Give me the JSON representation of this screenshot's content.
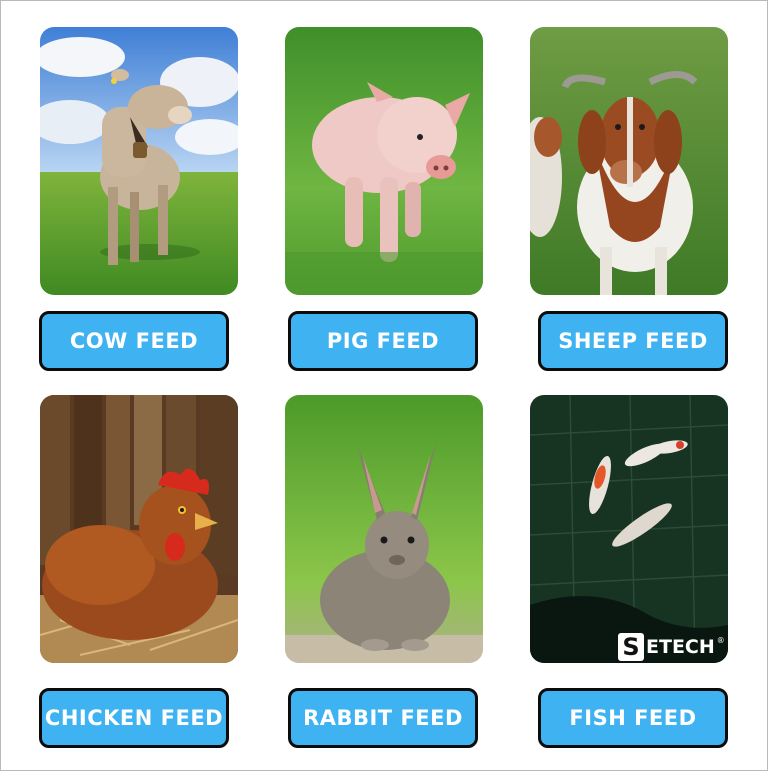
{
  "cards": [
    {
      "animal": "cow",
      "label": "COW FEED"
    },
    {
      "animal": "pig",
      "label": "PIG FEED"
    },
    {
      "animal": "goat",
      "label": "SHEEP FEED"
    },
    {
      "animal": "chicken",
      "label": "CHICKEN FEED"
    },
    {
      "animal": "rabbit",
      "label": "RABBIT FEED"
    },
    {
      "animal": "fish",
      "label": "FISH FEED"
    }
  ],
  "logo": {
    "initial": "S",
    "text": "ETECH",
    "reg_mark": "®"
  },
  "colors": {
    "button_fill": "#3fb2f2",
    "button_border": "#0b0b0b",
    "button_text": "#ffffff"
  }
}
